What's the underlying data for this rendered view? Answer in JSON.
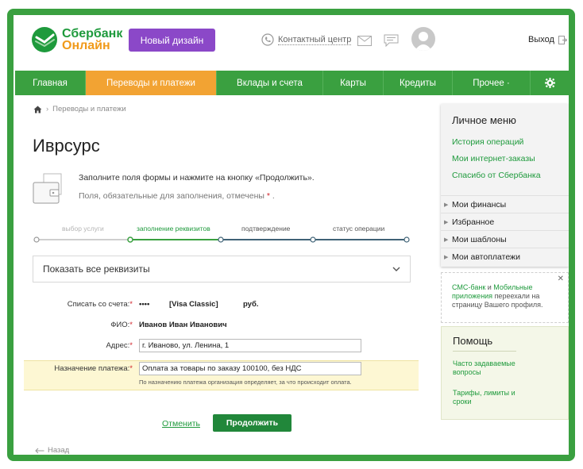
{
  "header": {
    "logo_line1": "Сбербанк",
    "logo_line2": "Онлайн",
    "new_design_label": "Новый дизайн",
    "contact_center_label": "Контактный центр",
    "exit_label": "Выход"
  },
  "nav": {
    "items": [
      {
        "label": "Главная",
        "active": false
      },
      {
        "label": "Переводы и платежи",
        "active": true
      },
      {
        "label": "Вклады и счета",
        "active": false
      },
      {
        "label": "Карты",
        "active": false
      },
      {
        "label": "Кредиты",
        "active": false
      },
      {
        "label": "Прочее ·",
        "active": false
      }
    ]
  },
  "breadcrumb": {
    "current": "Переводы и платежи"
  },
  "page": {
    "title": "Иврсурс",
    "hint_main": "Заполните поля формы и нажмите на кнопку «Продолжить».",
    "hint_required": "Поля, обязательные для заполнения, отмечены",
    "required_mark": "*",
    "period": "."
  },
  "steps": [
    {
      "label": "выбор услуги",
      "state": "done"
    },
    {
      "label": "заполнение реквизитов",
      "state": "current"
    },
    {
      "label": "подтверждение",
      "state": "upcoming"
    },
    {
      "label": "статус операции",
      "state": "upcoming"
    }
  ],
  "show_all": {
    "label": "Показать все реквизиты"
  },
  "form": {
    "account_label": "Списать со счета:",
    "account_masked": "••••",
    "account_card": "[Visa Classic]",
    "account_currency": "руб.",
    "fio_label": "ФИО:",
    "fio_value": "Иванов Иван Иванович",
    "address_label": "Адрес:",
    "address_value": "г. Иваново, ул. Ленина, 1",
    "purpose_label": "Назначение платежа:",
    "purpose_value": "Оплата за товары по заказу 100100, без НДС",
    "purpose_note": "По назначению платежа организация определяет, за что происходит оплата."
  },
  "actions": {
    "cancel_label": "Отменить",
    "continue_label": "Продолжить",
    "back_label": "Назад"
  },
  "sidebar": {
    "menu_title": "Личное меню",
    "links": [
      "История операций",
      "Мои интернет-заказы",
      "Спасибо от Сбербанка"
    ],
    "sections": [
      "Мои финансы",
      "Избранное",
      "Мои шаблоны",
      "Мои автоплатежи"
    ],
    "sms_part1": "СМС-банк",
    "sms_part2": " и ",
    "sms_part3": "Мобильные приложения",
    "sms_part4": " переехали на страницу Вашего профиля.",
    "help_title": "Помощь",
    "help_links": [
      "Часто задаваемые вопросы",
      "Тарифы, лимиты и сроки"
    ]
  },
  "colors": {
    "brand_green": "#3aa040",
    "active_tab": "#f2a333",
    "new_design": "#8b48c8",
    "button_green": "#21873a"
  }
}
